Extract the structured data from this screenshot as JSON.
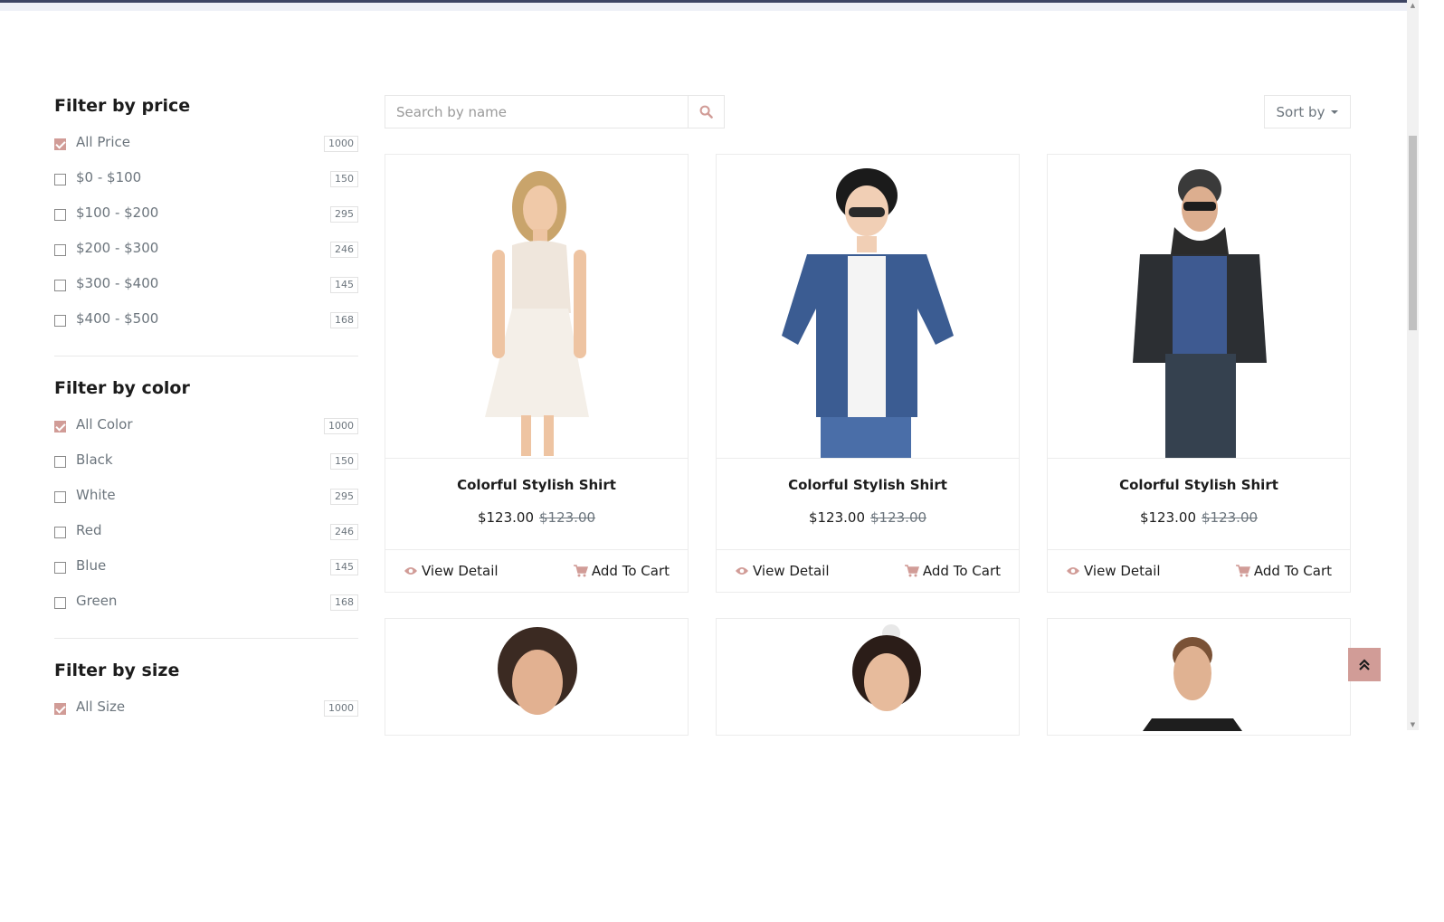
{
  "colors": {
    "accent": "#d19c97",
    "topbar": "#3d4564",
    "text": "#1c1c1c",
    "muted": "#6c757d"
  },
  "filters": {
    "price": {
      "title": "Filter by price",
      "options": [
        {
          "label": "All Price",
          "count": "1000",
          "checked": true
        },
        {
          "label": "$0 - $100",
          "count": "150",
          "checked": false
        },
        {
          "label": "$100 - $200",
          "count": "295",
          "checked": false
        },
        {
          "label": "$200 - $300",
          "count": "246",
          "checked": false
        },
        {
          "label": "$300 - $400",
          "count": "145",
          "checked": false
        },
        {
          "label": "$400 - $500",
          "count": "168",
          "checked": false
        }
      ]
    },
    "color": {
      "title": "Filter by color",
      "options": [
        {
          "label": "All Color",
          "count": "1000",
          "checked": true
        },
        {
          "label": "Black",
          "count": "150",
          "checked": false
        },
        {
          "label": "White",
          "count": "295",
          "checked": false
        },
        {
          "label": "Red",
          "count": "246",
          "checked": false
        },
        {
          "label": "Blue",
          "count": "145",
          "checked": false
        },
        {
          "label": "Green",
          "count": "168",
          "checked": false
        }
      ]
    },
    "size": {
      "title": "Filter by size",
      "options": [
        {
          "label": "All Size",
          "count": "1000",
          "checked": true
        }
      ]
    }
  },
  "toolbar": {
    "search_placeholder": "Search by name",
    "search_icon": "search-icon",
    "sort_label": "Sort by"
  },
  "products": [
    {
      "name": "Colorful Stylish Shirt",
      "price": "$123.00",
      "old_price": "$123.00",
      "view_label": "View Detail",
      "cart_label": "Add To Cart",
      "image": "woman-white-dress"
    },
    {
      "name": "Colorful Stylish Shirt",
      "price": "$123.00",
      "old_price": "$123.00",
      "view_label": "View Detail",
      "cart_label": "Add To Cart",
      "image": "boy-denim-jacket"
    },
    {
      "name": "Colorful Stylish Shirt",
      "price": "$123.00",
      "old_price": "$123.00",
      "view_label": "View Detail",
      "cart_label": "Add To Cart",
      "image": "man-leather-jacket"
    },
    {
      "image": "woman-portrait"
    },
    {
      "image": "girl-portrait"
    },
    {
      "image": "man-tuxedo"
    }
  ],
  "back_to_top_icon": "double-chevron-up-icon"
}
